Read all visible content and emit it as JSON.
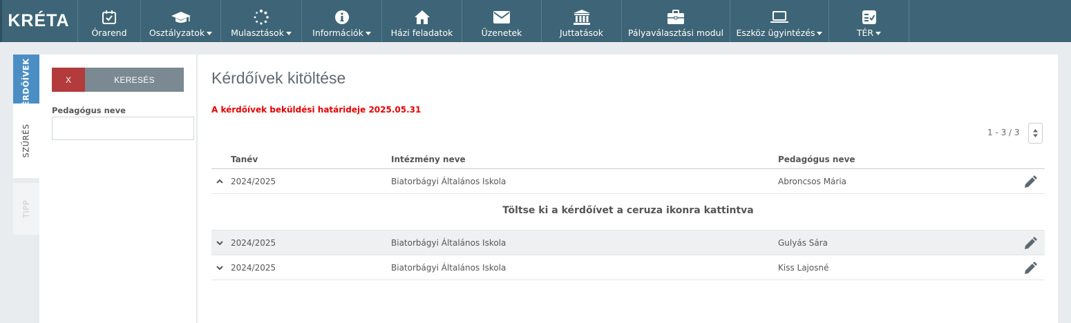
{
  "app": {
    "logo": "KRÉTA"
  },
  "nav": [
    {
      "label": "Órarend",
      "icon": "calendar-check-icon",
      "caret": false
    },
    {
      "label": "Osztályzatok",
      "icon": "graduation-cap-icon",
      "caret": true
    },
    {
      "label": "Mulasztások",
      "icon": "spinner-dots-icon",
      "caret": true
    },
    {
      "label": "Információk",
      "icon": "info-circle-icon",
      "caret": true
    },
    {
      "label": "Házi feladatok",
      "icon": "home-icon",
      "caret": false
    },
    {
      "label": "Üzenetek",
      "icon": "envelope-icon",
      "caret": false
    },
    {
      "label": "Juttatások",
      "icon": "bank-icon",
      "caret": false
    },
    {
      "label": "Pályaválasztási modul",
      "icon": "briefcase-icon",
      "caret": false
    },
    {
      "label": "Eszköz ügyintézés",
      "icon": "laptop-icon",
      "caret": true
    },
    {
      "label": "TÉR",
      "icon": "checklist-icon",
      "caret": true
    }
  ],
  "side_tabs": {
    "kerdoivek": "KÉRDŐÍVEK",
    "szures": "SZŰRÉS",
    "tipp": "TIPP"
  },
  "filter": {
    "clear_label": "X",
    "search_label": "KERESÉS",
    "teacher_label": "Pedagógus neve",
    "teacher_value": ""
  },
  "main": {
    "title": "Kérdőívek kitöltése",
    "deadline": "A kérdőívek beküldési határideje 2025.05.31",
    "pager": "1 - 3 / 3",
    "columns": {
      "tanev": "Tanév",
      "intezmeny": "Intézmény neve",
      "pedagogus": "Pedagógus neve"
    },
    "rows": [
      {
        "tanev": "2024/2025",
        "intezmeny": "Biatorbágyi Általános Iskola",
        "pedagogus": "Abroncsos Mária",
        "expanded": true
      },
      {
        "tanev": "2024/2025",
        "intezmeny": "Biatorbágyi Általános Iskola",
        "pedagogus": "Gulyás Sára",
        "expanded": false
      },
      {
        "tanev": "2024/2025",
        "intezmeny": "Biatorbágyi Általános Iskola",
        "pedagogus": "Kiss Lajosné",
        "expanded": false
      }
    ],
    "detail_text": "Töltse ki a kérdőívet a ceruza ikonra kattintva"
  },
  "colors": {
    "nav_bg": "#3e6577",
    "active_tab": "#4a8ec4",
    "clear_button": "#b33b3b",
    "search_button": "#7b8993",
    "deadline_text": "#e60000"
  }
}
